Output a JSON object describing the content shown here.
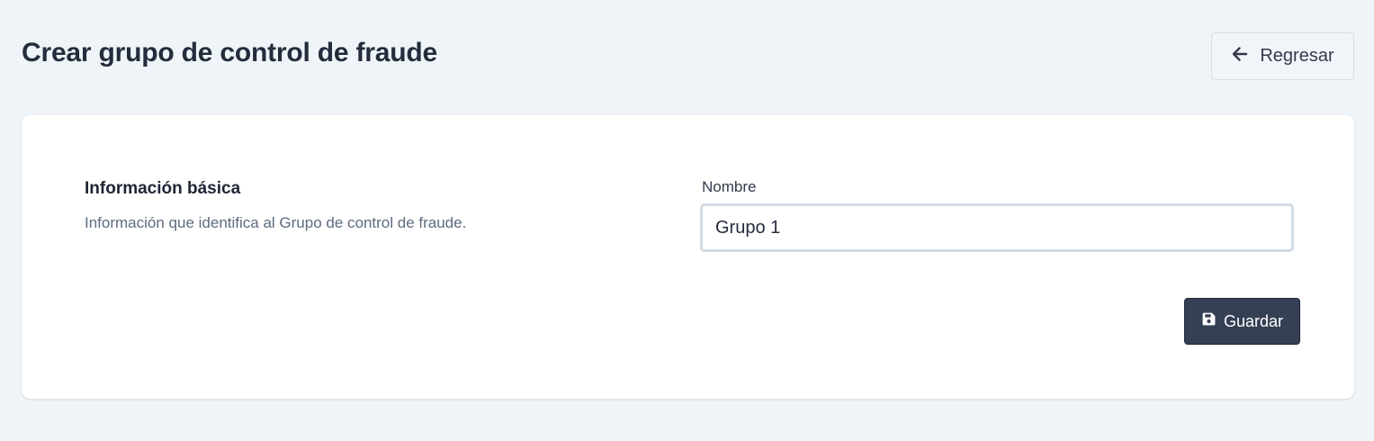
{
  "header": {
    "title": "Crear grupo de control de fraude",
    "back_label": "Regresar",
    "back_icon": "arrow-left-icon"
  },
  "section": {
    "title": "Información básica",
    "description": "Información que identifica al Grupo de control de fraude."
  },
  "form": {
    "name_label": "Nombre",
    "name_value": "Grupo 1",
    "save_label": "Guardar",
    "save_icon": "floppy-disk-icon"
  },
  "colors": {
    "background": "#eff4f8",
    "card": "#ffffff",
    "primary_button": "#364055",
    "text_dark": "#252c3c",
    "text_muted": "#5d6b80"
  }
}
